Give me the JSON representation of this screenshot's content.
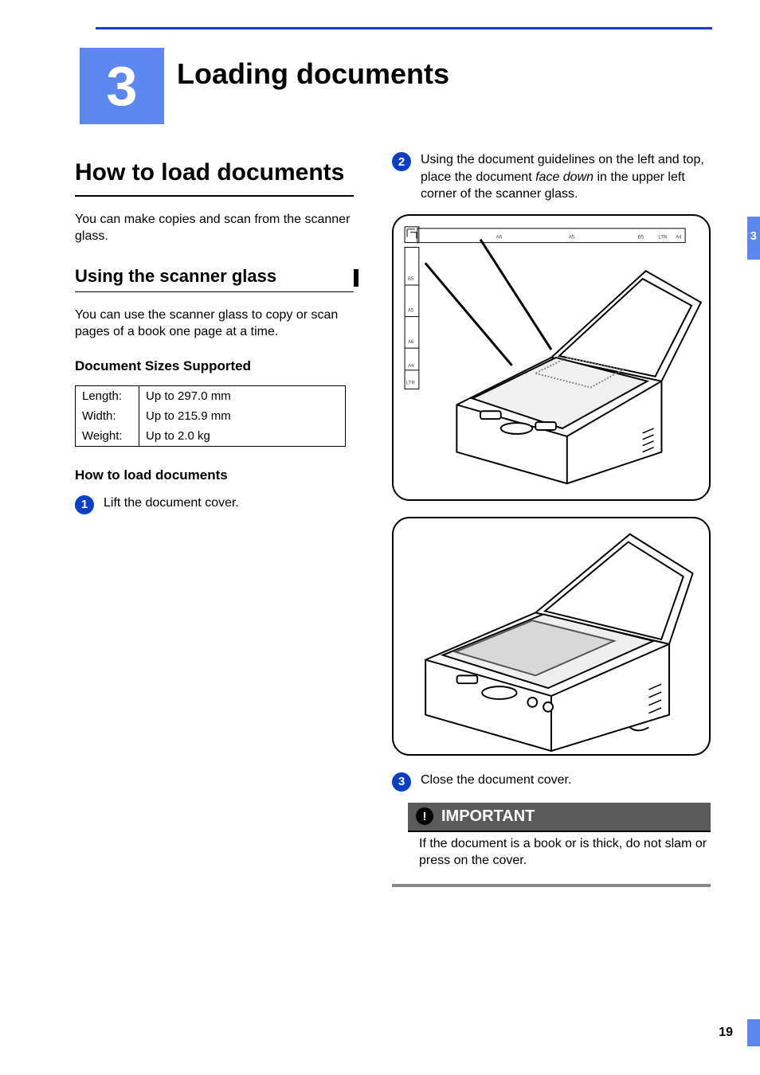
{
  "chapter": {
    "number": "3",
    "title": "Loading documents",
    "tab_label": "3"
  },
  "section": {
    "title": "How to load documents",
    "intro": "You can make copies and scan from the scanner glass."
  },
  "subsection": {
    "title": "Using the scanner glass",
    "intro": "You can use the scanner glass to copy or scan pages of a book one page at a time."
  },
  "doc_sizes": {
    "heading": "Document Sizes Supported",
    "rows": [
      {
        "label": "Length:",
        "value": "Up to 297.0 mm"
      },
      {
        "label": "Width:",
        "value": "Up to 215.9 mm"
      },
      {
        "label": "Weight:",
        "value": "Up to 2.0 kg"
      }
    ]
  },
  "howto": {
    "heading": "How to load documents",
    "steps": [
      {
        "num": "1",
        "text": "Lift the document cover."
      },
      {
        "num": "2",
        "text_pre": "Using the document guidelines on the left and top, place the document ",
        "text_em": "face down",
        "text_post": " in the upper left corner of the scanner glass."
      },
      {
        "num": "3",
        "text": "Close the document cover."
      }
    ]
  },
  "important": {
    "label": "IMPORTANT",
    "text": "If the document is a book or is thick, do not slam or press on the cover."
  },
  "ruler": {
    "top_marks": [
      "A6",
      "A5",
      "B5",
      "LTR",
      "A4"
    ],
    "side_marks": [
      "B5",
      "A5",
      "A6",
      "A4",
      "LTR"
    ]
  },
  "page_number": "19"
}
